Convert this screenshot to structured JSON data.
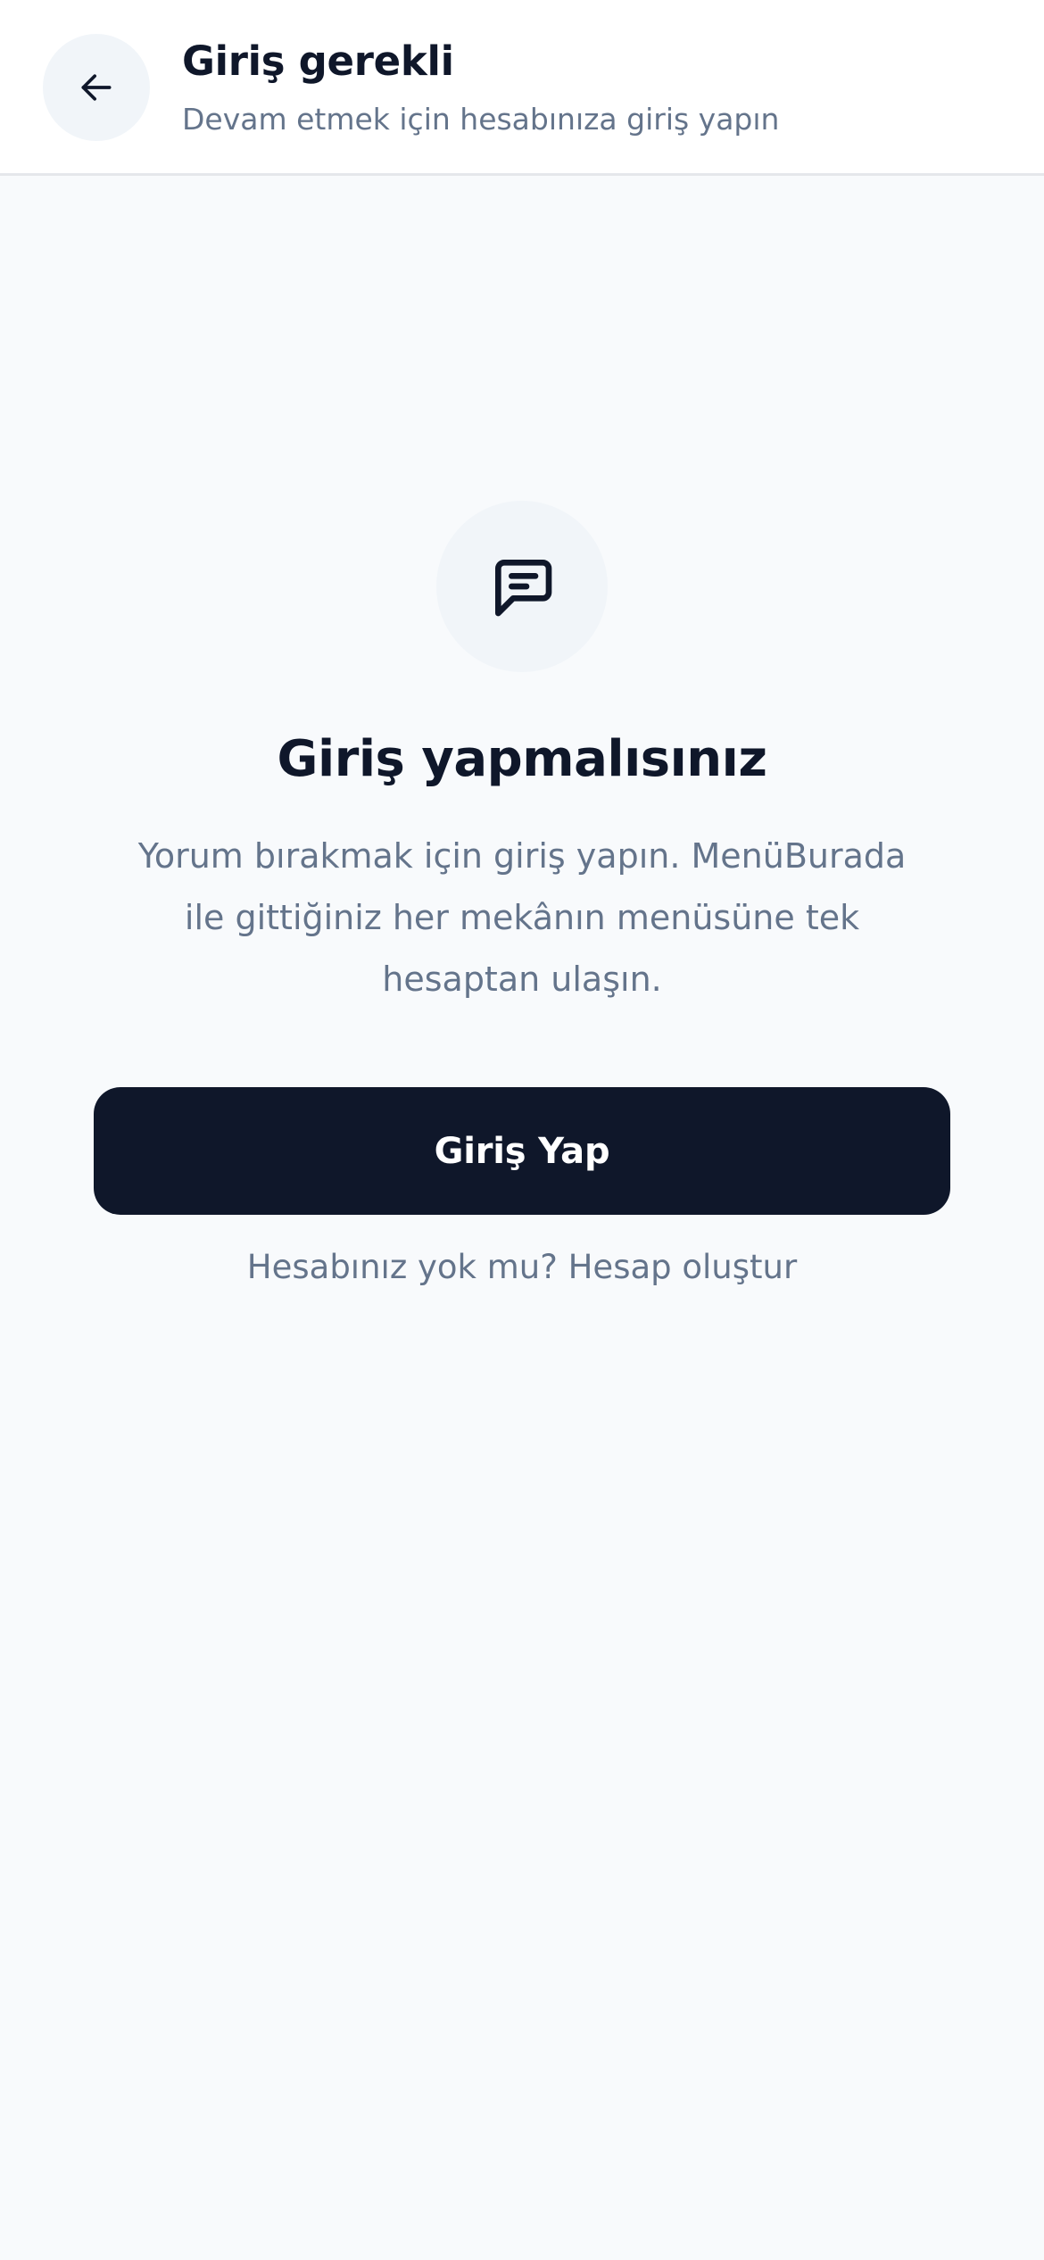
{
  "header": {
    "back_icon": "arrow-left-icon",
    "title": "Giriş gerekli",
    "subtitle": "Devam etmek için hesabınıza giriş yapın"
  },
  "empty_state": {
    "icon": "message-square-text-icon",
    "title": "Giriş yapmalısınız",
    "description": "Yorum bırakmak için giriş yapın. MenüBurada ile gittiğiniz her mekânın menüsüne tek hesaptan ulaşın."
  },
  "actions": {
    "login_label": "Giriş Yap",
    "signup_label": "Hesabınız yok mu? Hesap oluştur"
  },
  "colors": {
    "background": "#f8fafc",
    "primary": "#0f172a",
    "muted_text": "#64748b",
    "icon_background": "#f1f5f9"
  }
}
